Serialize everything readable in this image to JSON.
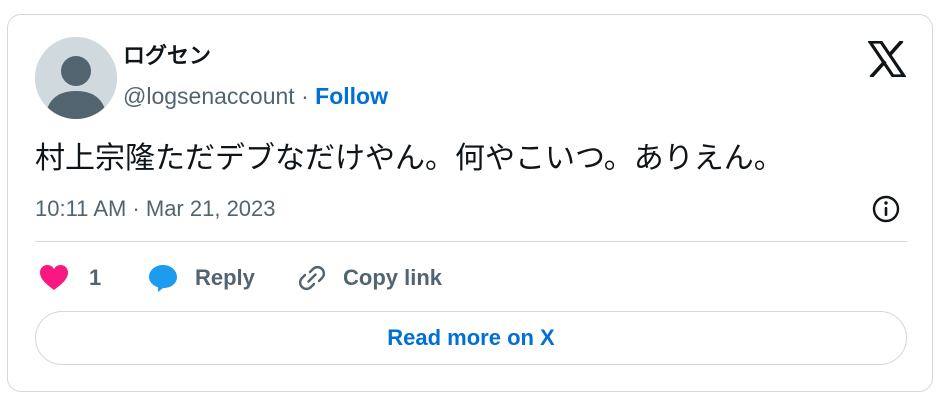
{
  "author": {
    "display_name": "ログセン",
    "handle": "@logsenaccount",
    "separator": "·",
    "follow_label": "Follow"
  },
  "tweet": {
    "text": "村上宗隆ただデブなだけやん。何やこいつ。ありえん。",
    "timestamp": "10:11 AM · Mar 21, 2023"
  },
  "actions": {
    "like_count": "1",
    "reply_label": "Reply",
    "copy_link_label": "Copy link"
  },
  "footer": {
    "read_more_label": "Read more on X"
  },
  "icons": {
    "brand": "x-logo-icon",
    "info": "info-icon",
    "like": "heart-icon",
    "reply": "speech-bubble-icon",
    "copy": "link-icon"
  },
  "colors": {
    "link_blue": "#006fd6",
    "heart_pink": "#f91880",
    "reply_blue": "#1d9bf0",
    "secondary_text": "#536471",
    "border": "#cfd9de"
  }
}
